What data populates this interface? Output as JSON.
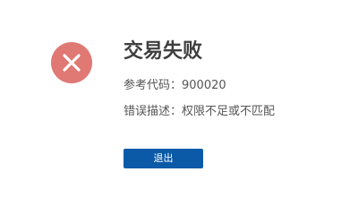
{
  "status": {
    "title": "交易失败",
    "icon": "error-x-icon",
    "icon_color": "#e07873"
  },
  "details": {
    "ref_label": "参考代码：",
    "ref_value": "900020",
    "error_label": "错误描述：",
    "error_value": "权限不足或不匹配"
  },
  "actions": {
    "exit_label": "退出",
    "exit_color": "#0a5aa8"
  }
}
